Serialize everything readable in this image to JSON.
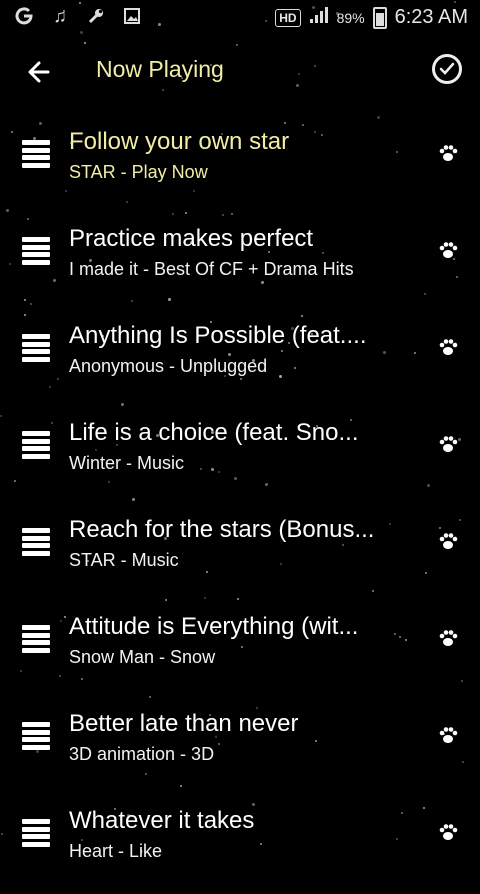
{
  "status_bar": {
    "hd": "HD",
    "battery": "89%",
    "time": "6:23 AM"
  },
  "header": {
    "title": "Now Playing"
  },
  "tracks": [
    {
      "title": "Follow your own star",
      "subtitle": "STAR - Play Now",
      "active": true
    },
    {
      "title": "Practice makes perfect",
      "subtitle": "I made it - Best Of CF + Drama Hits",
      "active": false
    },
    {
      "title": "Anything Is Possible (feat....",
      "subtitle": "Anonymous - Unplugged",
      "active": false
    },
    {
      "title": "Life is a choice (feat. Sno...",
      "subtitle": "Winter - Music",
      "active": false
    },
    {
      "title": "Reach for the stars (Bonus...",
      "subtitle": "STAR - Music",
      "active": false
    },
    {
      "title": "Attitude is Everything (wit...",
      "subtitle": "Snow Man - Snow",
      "active": false
    },
    {
      "title": "Better late than never",
      "subtitle": "3D animation - 3D",
      "active": false
    },
    {
      "title": "Whatever it takes",
      "subtitle": "Heart - Like",
      "active": false
    }
  ],
  "colors": {
    "accent": "#f1efa6",
    "background": "#000000"
  }
}
